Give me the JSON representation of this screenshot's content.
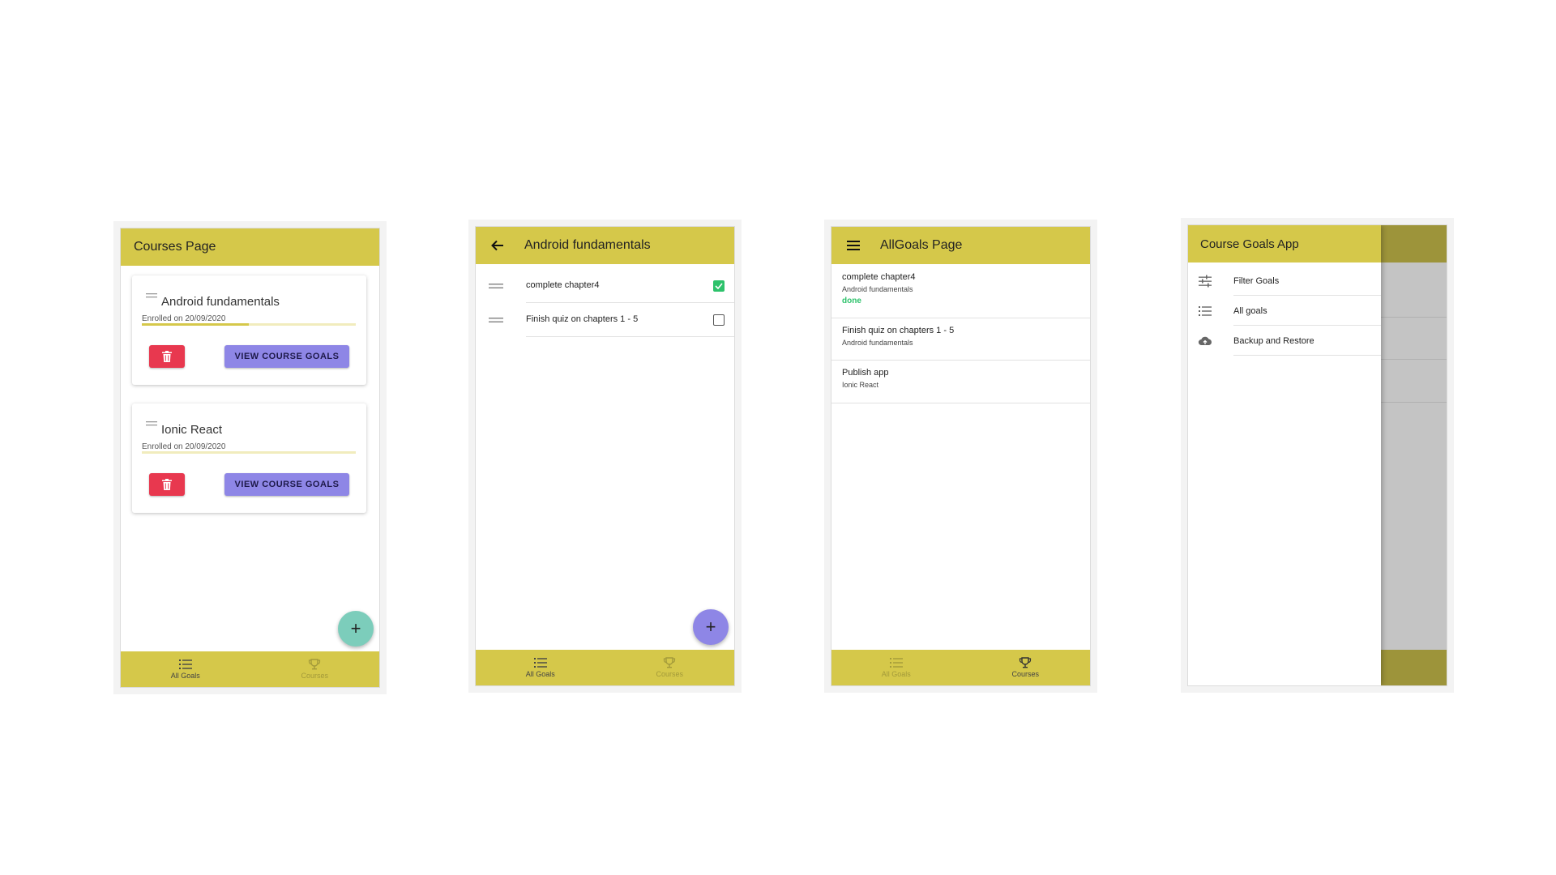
{
  "courses_page": {
    "title": "Courses Page",
    "cards": [
      {
        "title": "Android fundamentals",
        "enrolled": "Enrolled on 20/09/2020",
        "progress": 0.5,
        "view_label": "VIEW COURSE GOALS"
      },
      {
        "title": "Ionic React",
        "enrolled": "Enrolled on 20/09/2020",
        "progress": 0.0,
        "view_label": "VIEW COURSE GOALS"
      }
    ],
    "fab_label": "+",
    "fab_color": "#7ccdbb",
    "tabs": [
      {
        "label": "All Goals",
        "icon": "list-icon",
        "active": true
      },
      {
        "label": "Courses",
        "icon": "trophy-icon",
        "active": false
      }
    ]
  },
  "course_goals_page": {
    "title": "Android fundamentals",
    "goals": [
      {
        "text": "complete chapter4",
        "checked": true
      },
      {
        "text": "Finish quiz on chapters 1 - 5",
        "checked": false
      }
    ],
    "fab_label": "+",
    "fab_color": "#8e86e6",
    "tabs": [
      {
        "label": "All Goals",
        "icon": "list-icon",
        "active": true
      },
      {
        "label": "Courses",
        "icon": "trophy-icon",
        "active": false
      }
    ]
  },
  "all_goals_page": {
    "title": "AllGoals Page",
    "goals": [
      {
        "text": "complete chapter4",
        "course": "Android fundamentals",
        "status": "done"
      },
      {
        "text": "Finish quiz on chapters 1 - 5",
        "course": "Android fundamentals",
        "status": ""
      },
      {
        "text": "Publish app",
        "course": "Ionic React",
        "status": ""
      }
    ],
    "tabs": [
      {
        "label": "All Goals",
        "icon": "list-icon",
        "active": false
      },
      {
        "label": "Courses",
        "icon": "trophy-icon",
        "active": true
      }
    ]
  },
  "drawer": {
    "title": "Course Goals App",
    "items": [
      {
        "label": "Filter Goals",
        "icon": "sliders-icon"
      },
      {
        "label": "All goals",
        "icon": "list-icon"
      },
      {
        "label": "Backup and Restore",
        "icon": "cloud-upload-icon"
      }
    ]
  },
  "colors": {
    "header": "#d5c84a",
    "delete": "#e8384f",
    "view": "#8e86e6",
    "done": "#2dc26b"
  }
}
